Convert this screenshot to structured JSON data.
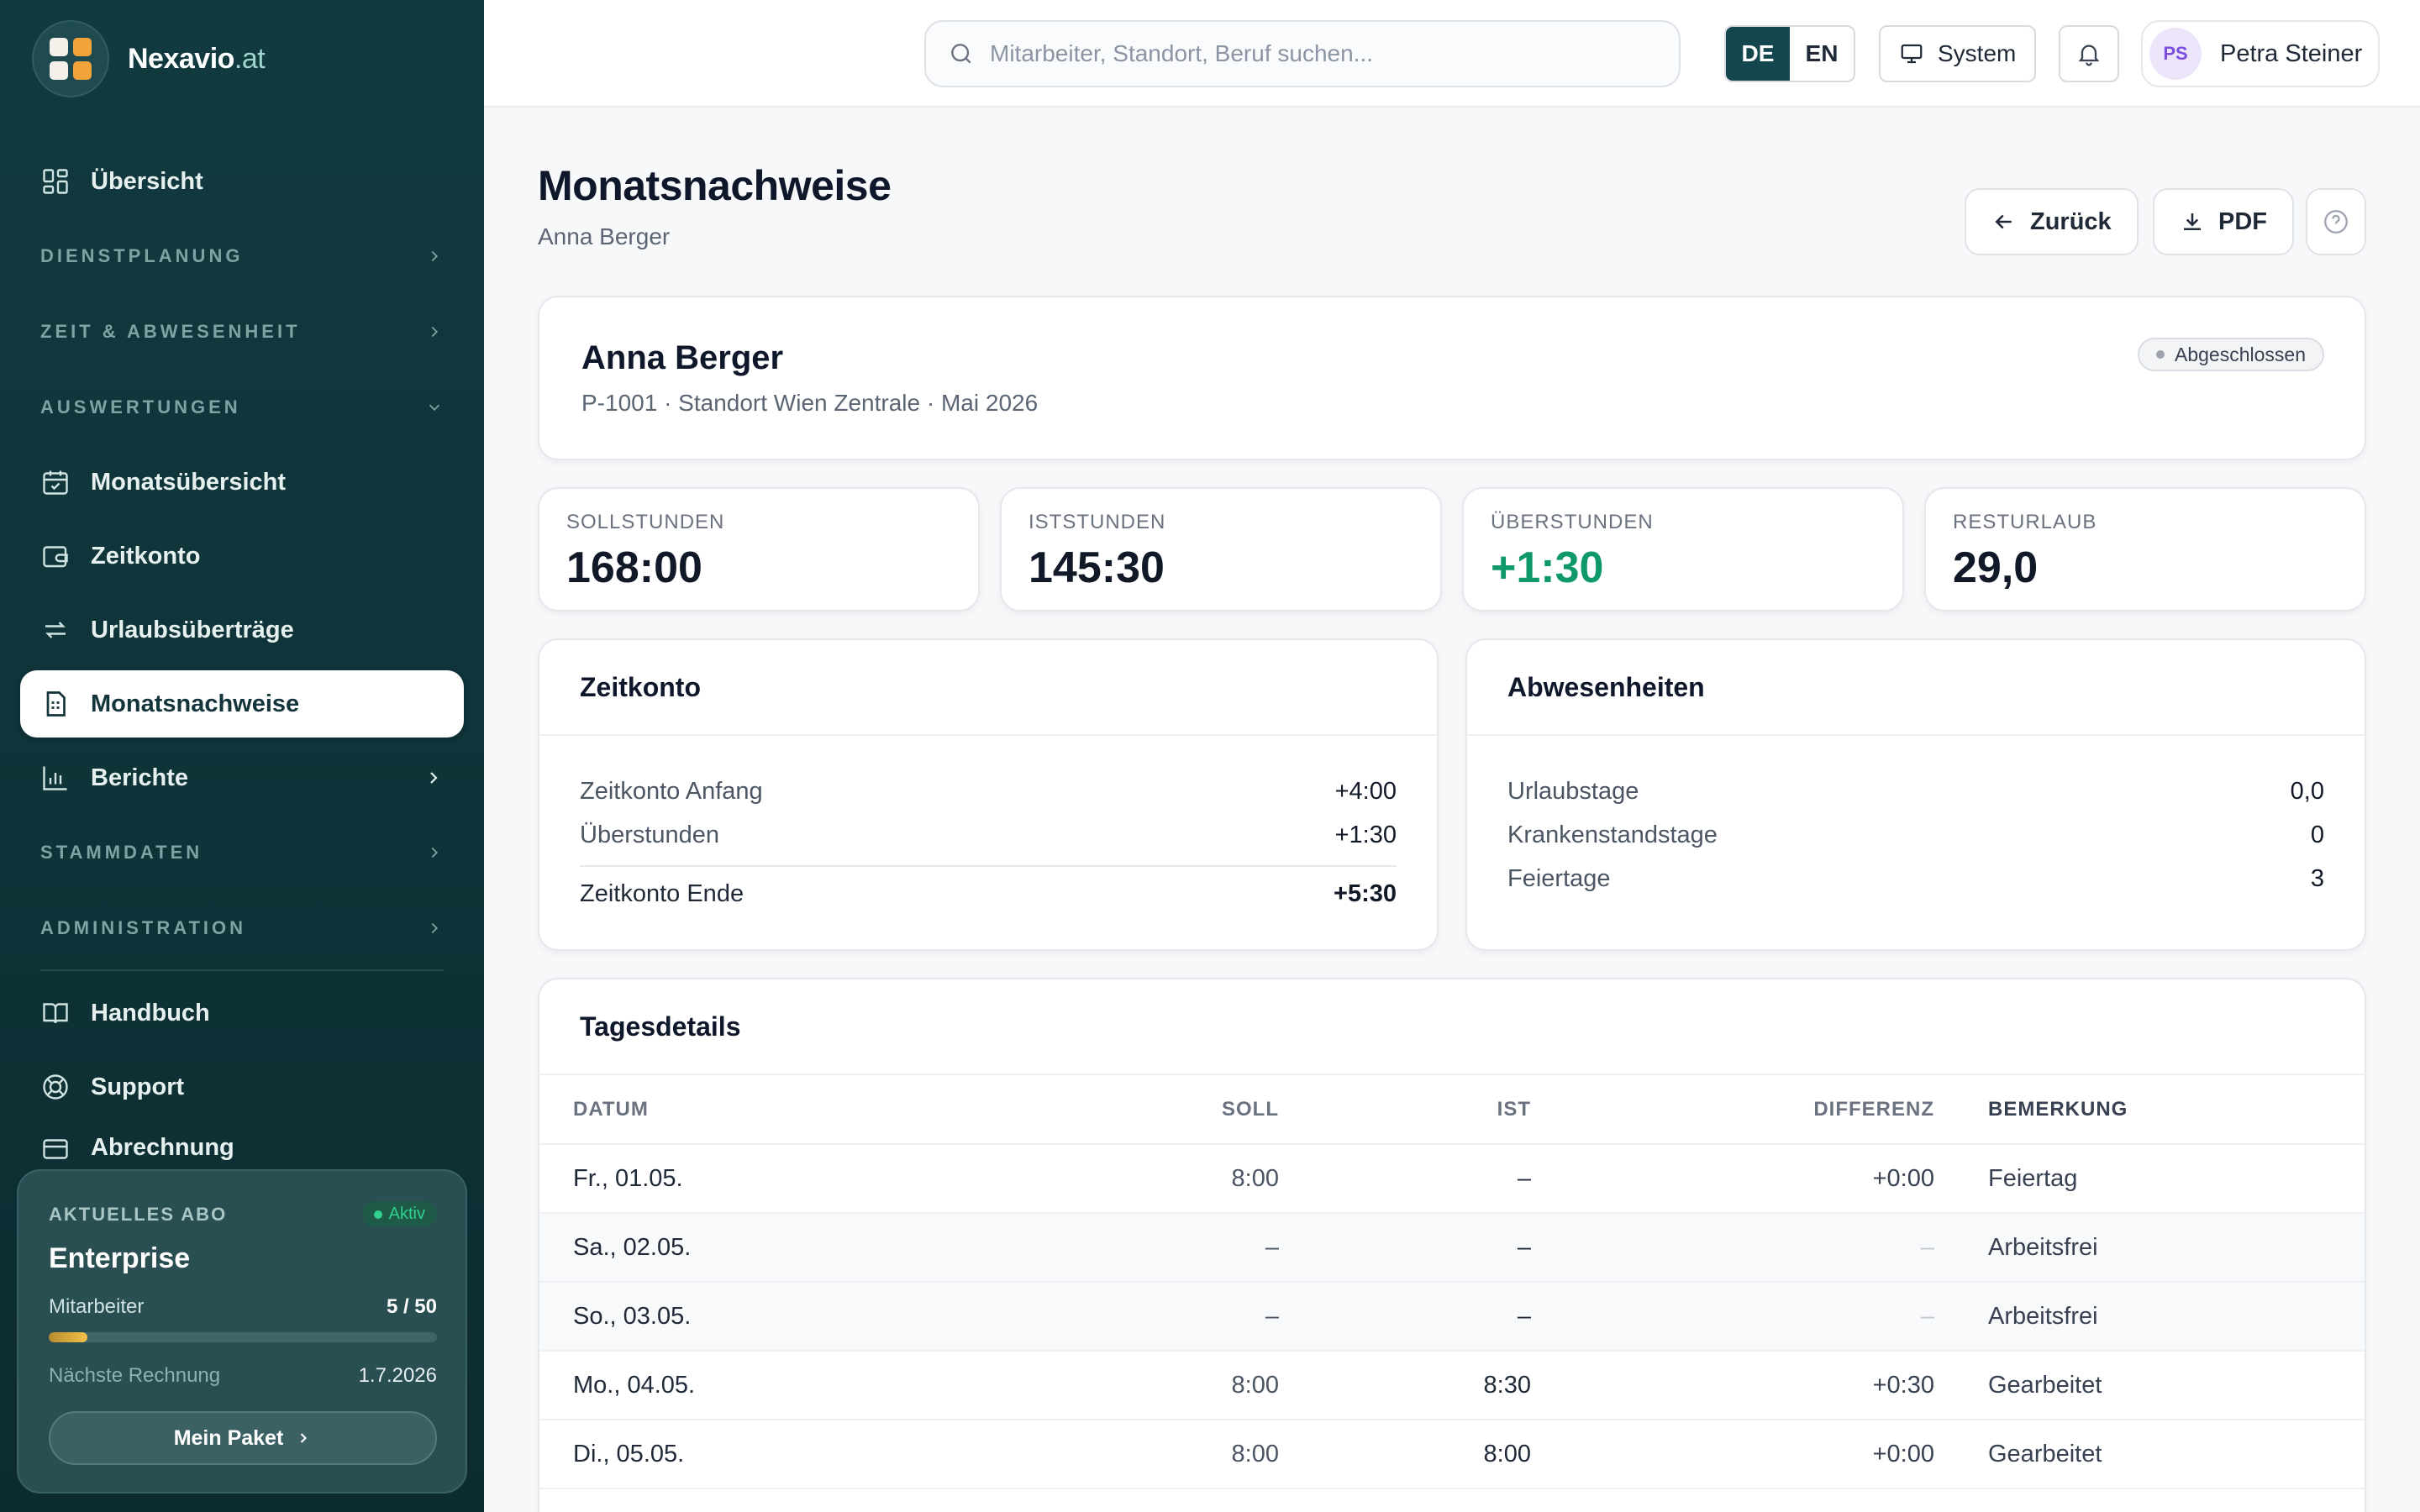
{
  "brand": {
    "name": "Nexavio",
    "tld": ".at"
  },
  "sidebar": {
    "overview": "Übersicht",
    "sections": {
      "dienstplanung": "DIENSTPLANUNG",
      "zeit": "ZEIT & ABWESENHEIT",
      "auswertungen": "AUSWERTUNGEN",
      "stammdaten": "STAMMDATEN",
      "administration": "ADMINISTRATION"
    },
    "items": {
      "monatsuebersicht": "Monatsübersicht",
      "zeitkonto": "Zeitkonto",
      "urlaub": "Urlaubsüberträge",
      "monatsnachweise": "Monatsnachweise",
      "berichte": "Berichte",
      "handbuch": "Handbuch",
      "support": "Support",
      "abrechnung": "Abrechnung"
    },
    "abo": {
      "label": "AKTUELLES ABO",
      "status": "Aktiv",
      "plan": "Enterprise",
      "employees_label": "Mitarbeiter",
      "employees_value": "5 / 50",
      "employees_fraction": 0.1,
      "invoice_label": "Nächste Rechnung",
      "invoice_date": "1.7.2026",
      "button": "Mein Paket"
    }
  },
  "topbar": {
    "search_placeholder": "Mitarbeiter, Standort, Beruf suchen...",
    "lang_de": "DE",
    "lang_en": "EN",
    "theme": "System",
    "user_initials": "PS",
    "user_name": "Petra Steiner"
  },
  "header": {
    "title": "Monatsnachweise",
    "subtitle": "Anna Berger",
    "back": "Zurück",
    "pdf": "PDF"
  },
  "employee": {
    "name": "Anna Berger",
    "meta": "P-1001 · Standort Wien Zentrale · Mai 2026",
    "status": "Abgeschlossen"
  },
  "stats": {
    "soll_label": "SOLLSTUNDEN",
    "soll_value": "168:00",
    "ist_label": "ISTSTUNDEN",
    "ist_value": "145:30",
    "ueber_label": "ÜBERSTUNDEN",
    "ueber_value": "+1:30",
    "rest_label": "RESTURLAUB",
    "rest_value": "29,0"
  },
  "zeitkonto": {
    "title": "Zeitkonto",
    "start_label": "Zeitkonto Anfang",
    "start_value": "+4:00",
    "over_label": "Überstunden",
    "over_value": "+1:30",
    "end_label": "Zeitkonto Ende",
    "end_value": "+5:30"
  },
  "abwesenheiten": {
    "title": "Abwesenheiten",
    "urlaub_label": "Urlaubstage",
    "urlaub_value": "0,0",
    "krank_label": "Krankenstandstage",
    "krank_value": "0",
    "feier_label": "Feiertage",
    "feier_value": "3"
  },
  "tagesdetails": {
    "title": "Tagesdetails",
    "columns": {
      "datum": "DATUM",
      "soll": "SOLL",
      "ist": "IST",
      "diff": "DIFFERENZ",
      "note": "BEMERKUNG"
    },
    "rows": [
      {
        "datum": "Fr., 01.05.",
        "soll": "8:00",
        "ist": "–",
        "diff": "+0:00",
        "note": "Feiertag"
      },
      {
        "datum": "Sa., 02.05.",
        "soll": "–",
        "ist": "–",
        "diff": "–",
        "note": "Arbeitsfrei"
      },
      {
        "datum": "So., 03.05.",
        "soll": "–",
        "ist": "–",
        "diff": "–",
        "note": "Arbeitsfrei"
      },
      {
        "datum": "Mo., 04.05.",
        "soll": "8:00",
        "ist": "8:30",
        "diff": "+0:30",
        "note": "Gearbeitet"
      },
      {
        "datum": "Di., 05.05.",
        "soll": "8:00",
        "ist": "8:00",
        "diff": "+0:00",
        "note": "Gearbeitet"
      }
    ]
  }
}
